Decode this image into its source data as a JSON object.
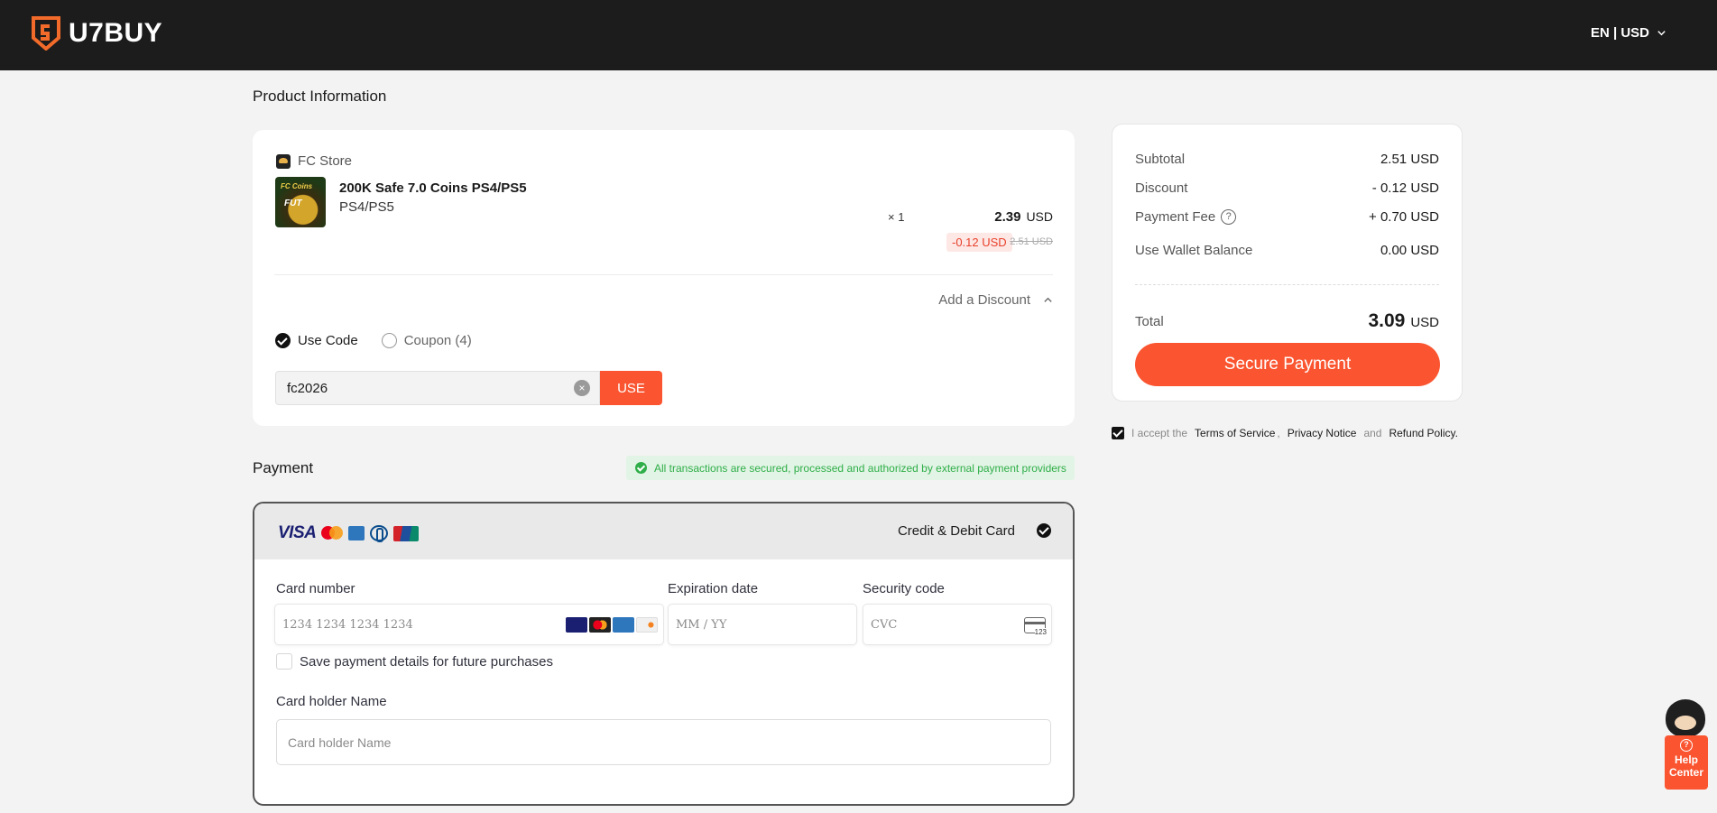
{
  "header": {
    "logo_text": "U7BUY",
    "locale": "EN | USD"
  },
  "product_section": {
    "title": "Product Information",
    "store_name": "FC Store",
    "thumb_label": "FC Coins",
    "thumb_badge": "FUT",
    "product_name": "200K Safe 7.0 Coins PS4/PS5",
    "platform": "PS4/PS5",
    "quantity": "× 1",
    "price": "2.39",
    "currency": "USD",
    "discount_badge": "-0.12 USD",
    "original_price": "2.51 USD",
    "add_discount_label": "Add a Discount",
    "use_code_label": "Use Code",
    "coupon_label": "Coupon (4)",
    "code_value": "fc2026",
    "use_button": "USE"
  },
  "payment_section": {
    "title": "Payment",
    "secure_notice": "All transactions are secured, processed and authorized by external payment providers",
    "method_title": "Credit & Debit Card",
    "brand_visa": "VISA",
    "card_number_label": "Card number",
    "card_number_placeholder": "1234 1234 1234 1234",
    "expiration_label": "Expiration date",
    "expiration_placeholder": "MM / YY",
    "security_label": "Security code",
    "security_placeholder": "CVC",
    "save_label": "Save payment details for future purchases",
    "holder_label": "Card holder Name",
    "holder_placeholder": "Card holder Name"
  },
  "summary": {
    "rows": [
      {
        "label": "Subtotal",
        "value": "2.51 USD"
      },
      {
        "label": "Discount",
        "value": "- 0.12 USD"
      },
      {
        "label": "Payment Fee",
        "value": "+ 0.70 USD"
      },
      {
        "label": "Use Wallet Balance",
        "value": "0.00 USD"
      }
    ],
    "total_label": "Total",
    "total_value": "3.09",
    "total_currency": "USD",
    "pay_button": "Secure Payment"
  },
  "terms": {
    "prefix": "I accept the",
    "tos": "Terms of Service",
    "sep": ",",
    "privacy": "Privacy Notice",
    "and": "and",
    "refund": "Refund Policy."
  },
  "help": {
    "label": "Help Center",
    "icon": "?"
  },
  "colors": {
    "accent": "#fa5530",
    "header_bg": "#1c1c1c",
    "secure_green": "#2fae49"
  }
}
